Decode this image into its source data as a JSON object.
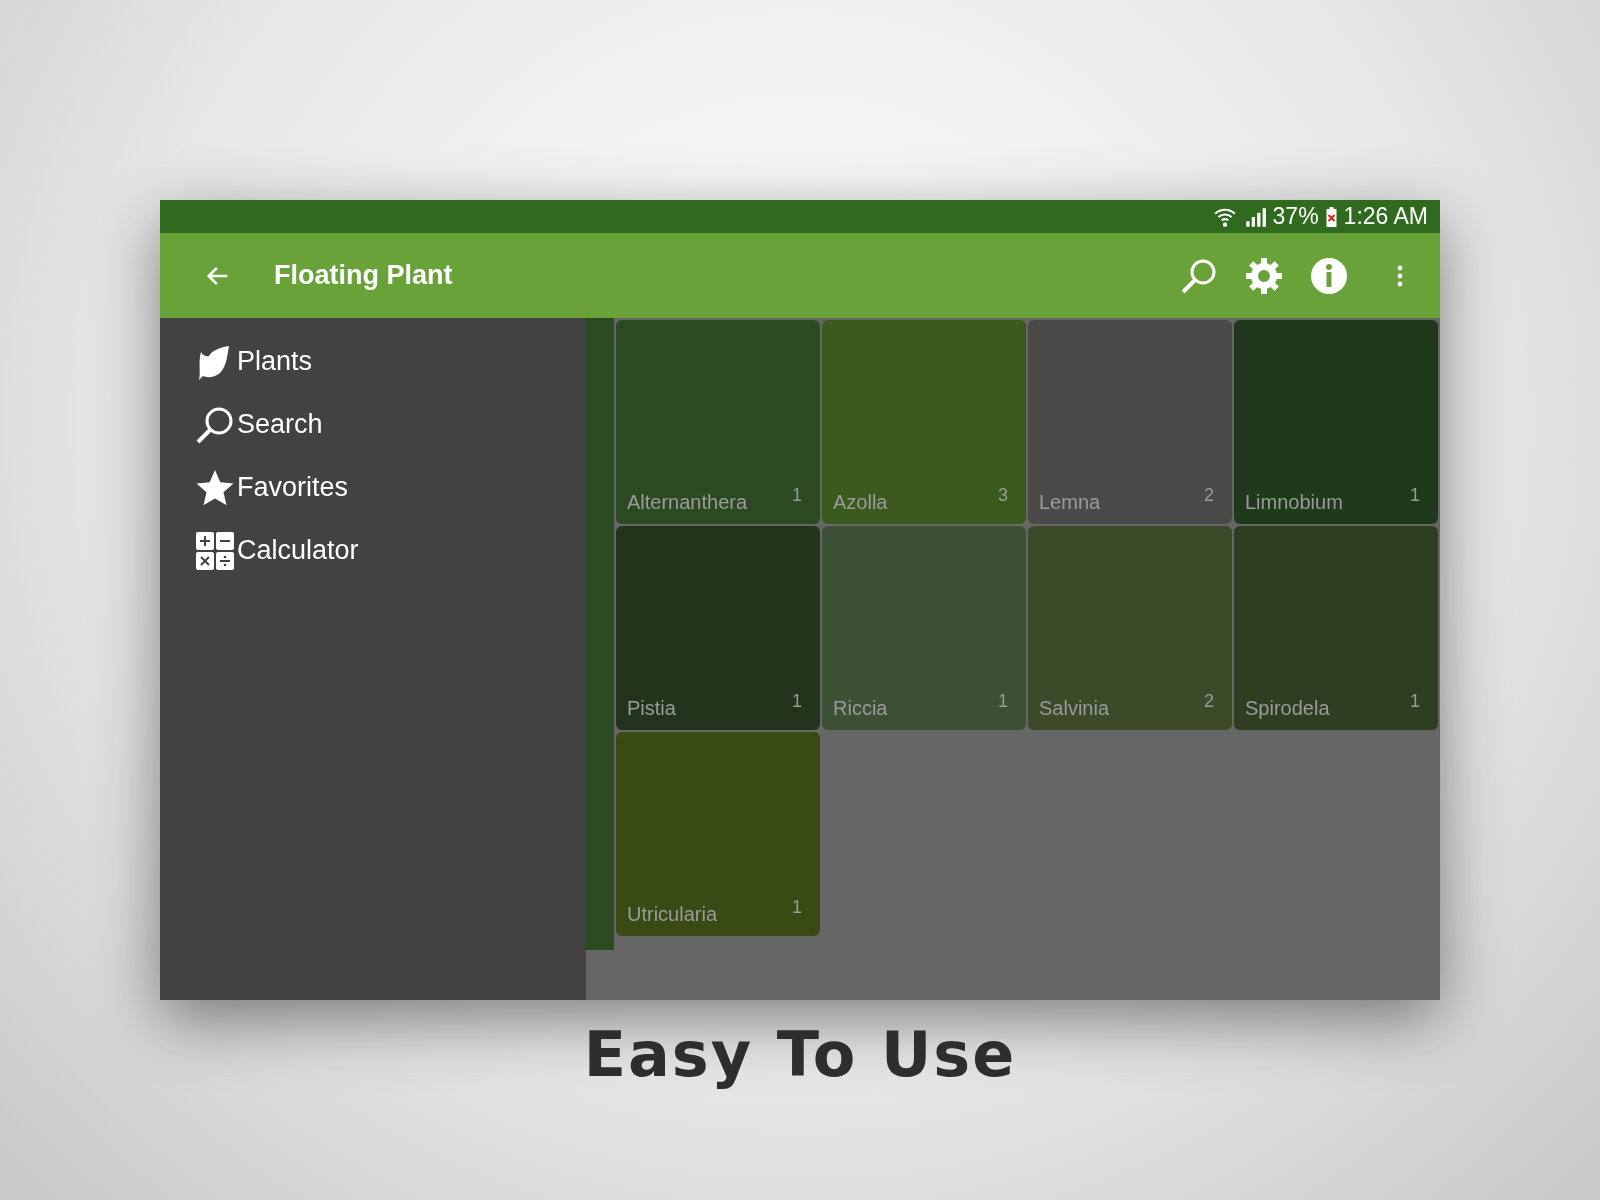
{
  "status_bar": {
    "battery": "37%",
    "time": "1:26 AM"
  },
  "app_bar": {
    "title": "Floating Plant"
  },
  "drawer": {
    "items": [
      {
        "kind": "plants",
        "label": "Plants"
      },
      {
        "kind": "search",
        "label": "Search"
      },
      {
        "kind": "favorites",
        "label": "Favorites"
      },
      {
        "kind": "calculator",
        "label": "Calculator"
      }
    ]
  },
  "grid": {
    "tiles": [
      {
        "name": "Alternanthera",
        "count": "1"
      },
      {
        "name": "Azolla",
        "count": "3"
      },
      {
        "name": "Lemna",
        "count": "2"
      },
      {
        "name": "Limnobium",
        "count": "1"
      },
      {
        "name": "Pistia",
        "count": "1"
      },
      {
        "name": "Riccia",
        "count": "1"
      },
      {
        "name": "Salvinia",
        "count": "2"
      },
      {
        "name": "Spirodela",
        "count": "1"
      },
      {
        "name": "Utricularia",
        "count": "1"
      }
    ]
  },
  "caption": "Easy To Use"
}
